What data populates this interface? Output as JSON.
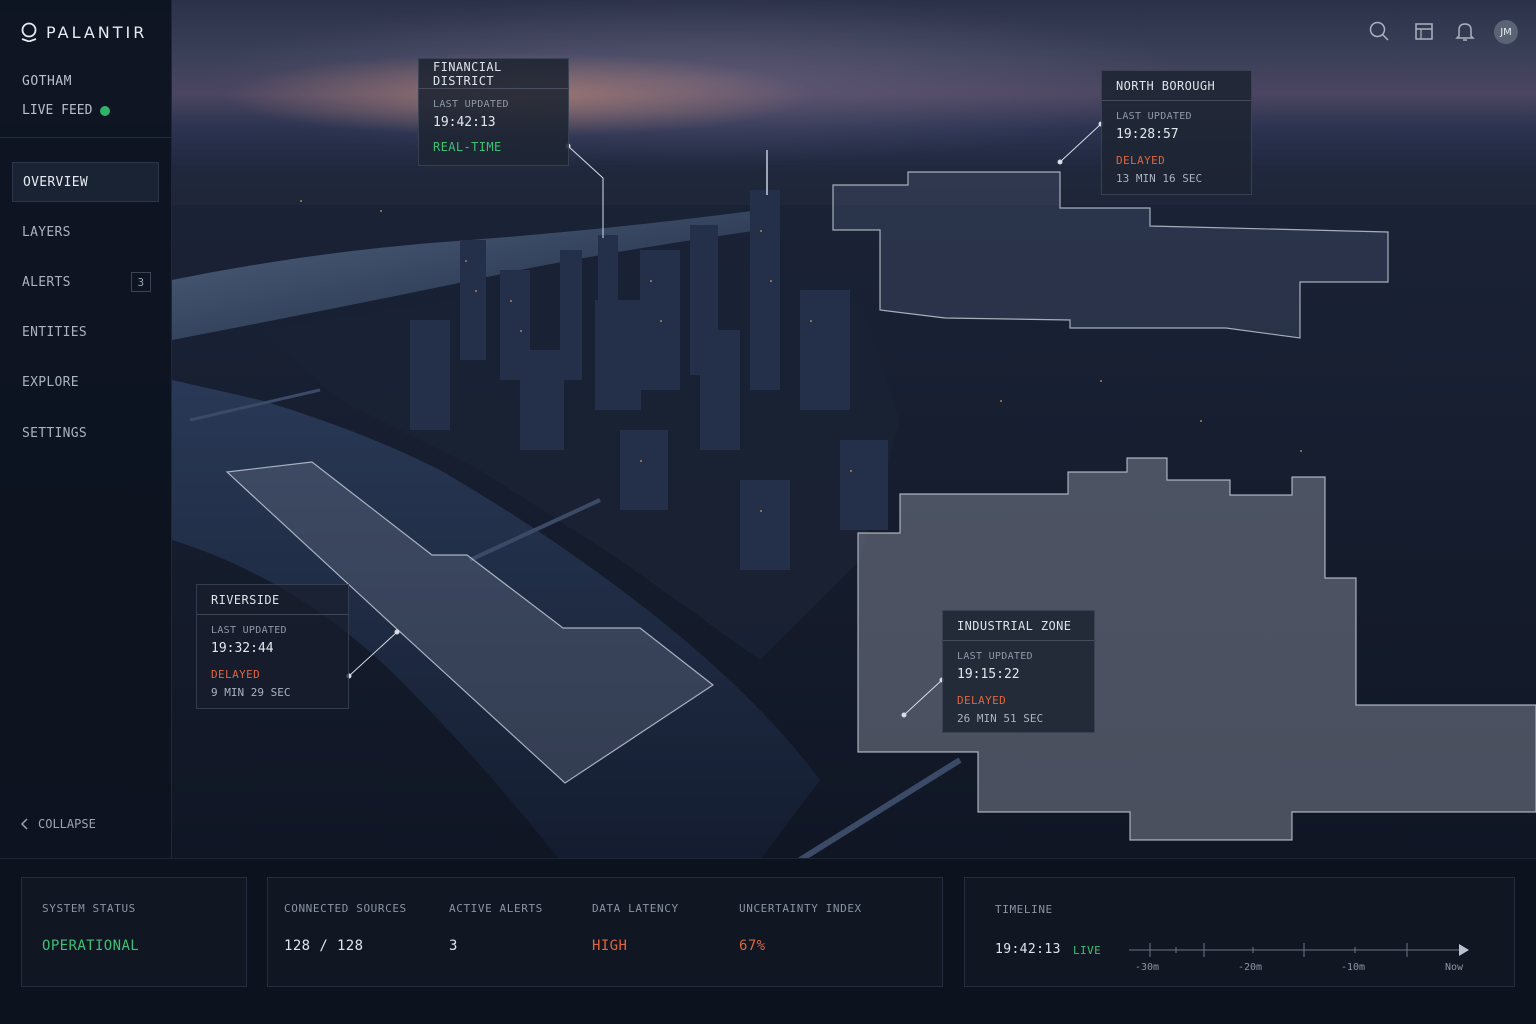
{
  "app": {
    "name": "PALANTIR",
    "workspace": "GOTHAM",
    "feed_label": "LIVE FEED",
    "feed_color": "#2fb36b"
  },
  "sidebar": {
    "items": [
      {
        "label": "OVERVIEW",
        "active": true
      },
      {
        "label": "LAYERS"
      },
      {
        "label": "ALERTS",
        "badge": "3"
      },
      {
        "label": "ENTITIES"
      },
      {
        "label": "EXPLORE"
      },
      {
        "label": "SETTINGS"
      }
    ],
    "collapse_label": "COLLAPSE"
  },
  "header": {
    "icons": [
      "search-icon",
      "calendar-icon",
      "bell-icon"
    ],
    "avatar_initials": "JM"
  },
  "regions": [
    {
      "name": "FINANCIAL DISTRICT",
      "last_updated_label": "LAST UPDATED",
      "time": "19:42:13",
      "status": "REAL-TIME",
      "status_color": "#3fbf74"
    },
    {
      "name": "NORTH BOROUGH",
      "last_updated_label": "LAST UPDATED",
      "time": "19:28:57",
      "status": "DELAYED",
      "delay": "13 MIN 16 SEC",
      "status_color": "#e0653e"
    },
    {
      "name": "RIVERSIDE",
      "last_updated_label": "LAST UPDATED",
      "time": "19:32:44",
      "status": "DELAYED",
      "delay": "9 MIN 29 SEC",
      "status_color": "#e0653e"
    },
    {
      "name": "INDUSTRIAL ZONE",
      "last_updated_label": "LAST UPDATED",
      "time": "19:15:22",
      "status": "DELAYED",
      "delay": "26 MIN 51 SEC",
      "status_color": "#e0653e"
    }
  ],
  "status_bar": {
    "system_status": {
      "label": "SYSTEM STATUS",
      "value": "OPERATIONAL"
    },
    "connected_sources": {
      "label": "CONNECTED SOURCES",
      "value": "128 / 128"
    },
    "active_alerts": {
      "label": "ACTIVE ALERTS",
      "value": "3"
    },
    "data_latency": {
      "label": "DATA LATENCY",
      "value": "HIGH"
    },
    "uncertainty_index": {
      "label": "UNCERTAINTY INDEX",
      "value": "67%"
    }
  },
  "timeline": {
    "label": "TIMELINE",
    "time": "19:42:13",
    "mode": "LIVE",
    "ticks": [
      "-30m",
      "-20m",
      "-10m",
      "Now"
    ]
  }
}
